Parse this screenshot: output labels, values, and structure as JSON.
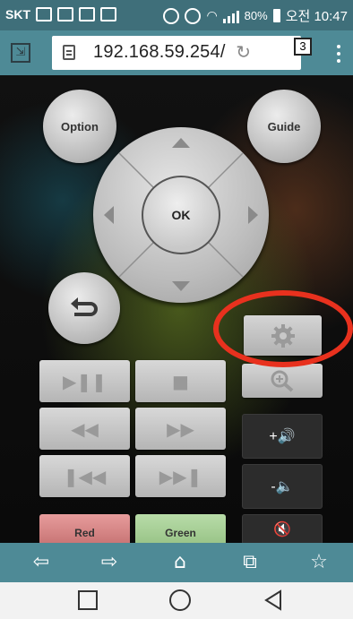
{
  "status_bar": {
    "carrier": "SKT",
    "battery": "80%",
    "time": "오전 10:47"
  },
  "browser": {
    "url": "192.168.59.254/",
    "tab_count": "3",
    "fullscreen_glyph": "⇲",
    "reload_glyph": "↻",
    "bottom_toolbar": {
      "back": "⇦",
      "forward": "⇨",
      "home": "⌂",
      "tabs": "⧉",
      "bookmark": "☆"
    }
  },
  "remote": {
    "option_label": "Option",
    "guide_label": "Guide",
    "ok_label": "OK",
    "red_label": "Red",
    "green_label": "Green",
    "playback": {
      "play_pause": "▶❚❚",
      "stop": "■",
      "rewind": "◀◀",
      "fast_forward": "▶▶",
      "previous": "❚◀◀",
      "next": "▶▶❚"
    },
    "volume": {
      "up": "+🔊",
      "down": "-🔈",
      "mute": "🔇"
    }
  },
  "annotation": {
    "color": "#e8311e",
    "target": "settings-button"
  }
}
